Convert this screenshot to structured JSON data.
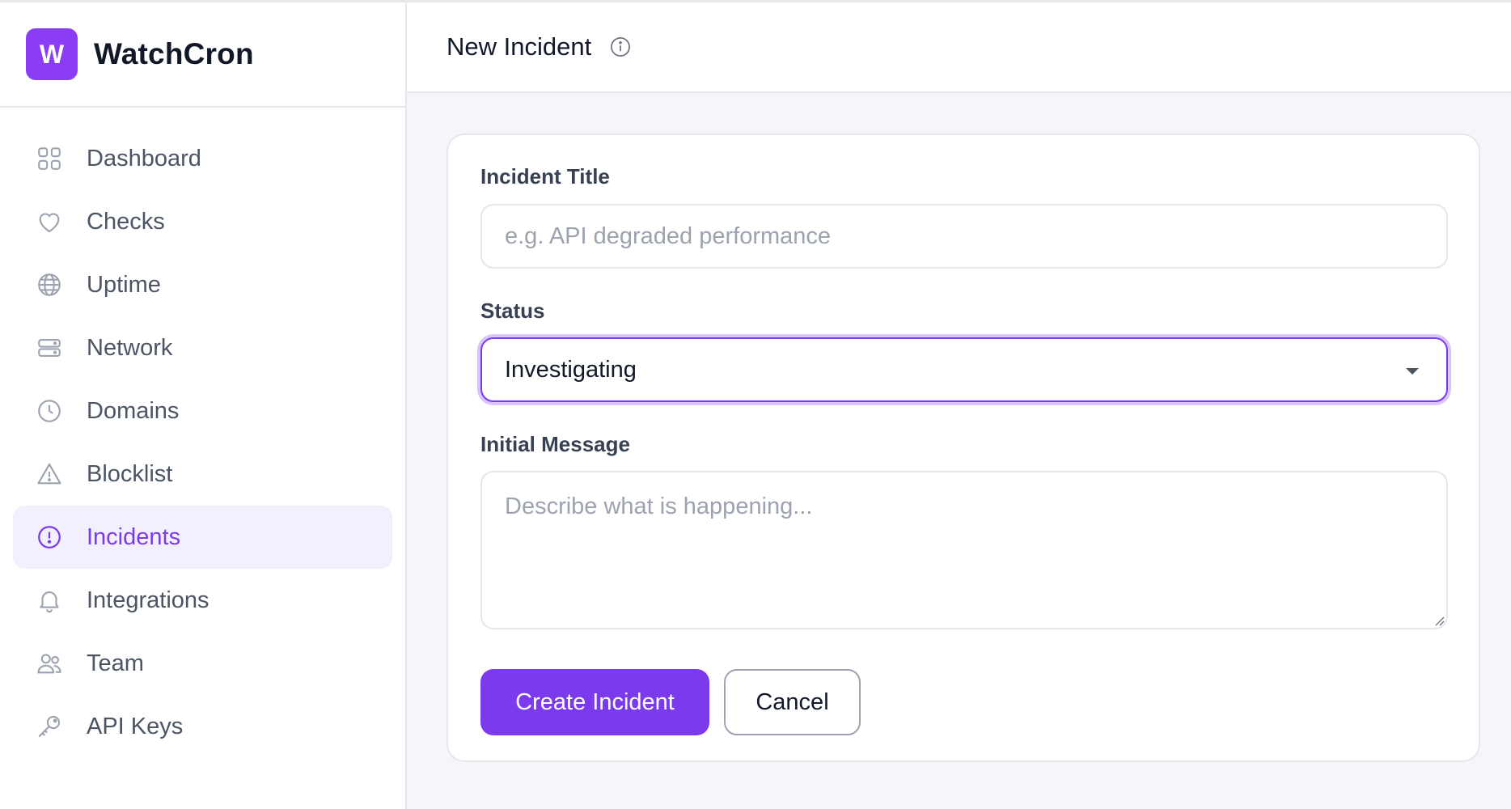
{
  "brand": {
    "logo_letter": "W",
    "name": "WatchCron",
    "accent": "#8b3cf5"
  },
  "sidebar": {
    "items": [
      {
        "label": "Dashboard",
        "icon": "dashboard-grid-icon"
      },
      {
        "label": "Checks",
        "icon": "heart-icon"
      },
      {
        "label": "Uptime",
        "icon": "globe-icon"
      },
      {
        "label": "Network",
        "icon": "server-icon"
      },
      {
        "label": "Domains",
        "icon": "clock-icon"
      },
      {
        "label": "Blocklist",
        "icon": "warning-triangle-icon"
      },
      {
        "label": "Incidents",
        "icon": "alert-circle-icon",
        "active": true
      },
      {
        "label": "Integrations",
        "icon": "bell-icon"
      },
      {
        "label": "Team",
        "icon": "users-icon"
      },
      {
        "label": "API Keys",
        "icon": "key-icon"
      }
    ]
  },
  "header": {
    "title": "New Incident",
    "info_icon": "info-icon"
  },
  "form": {
    "title_label": "Incident Title",
    "title_placeholder": "e.g. API degraded performance",
    "title_value": "",
    "status_label": "Status",
    "status_value": "Investigating",
    "message_label": "Initial Message",
    "message_placeholder": "Describe what is happening...",
    "message_value": "",
    "create_label": "Create Incident",
    "cancel_label": "Cancel"
  },
  "colors": {
    "primary": "#7c3aed",
    "active_bg": "#f3f0fd",
    "focus_ring": "#d8c5fb"
  }
}
